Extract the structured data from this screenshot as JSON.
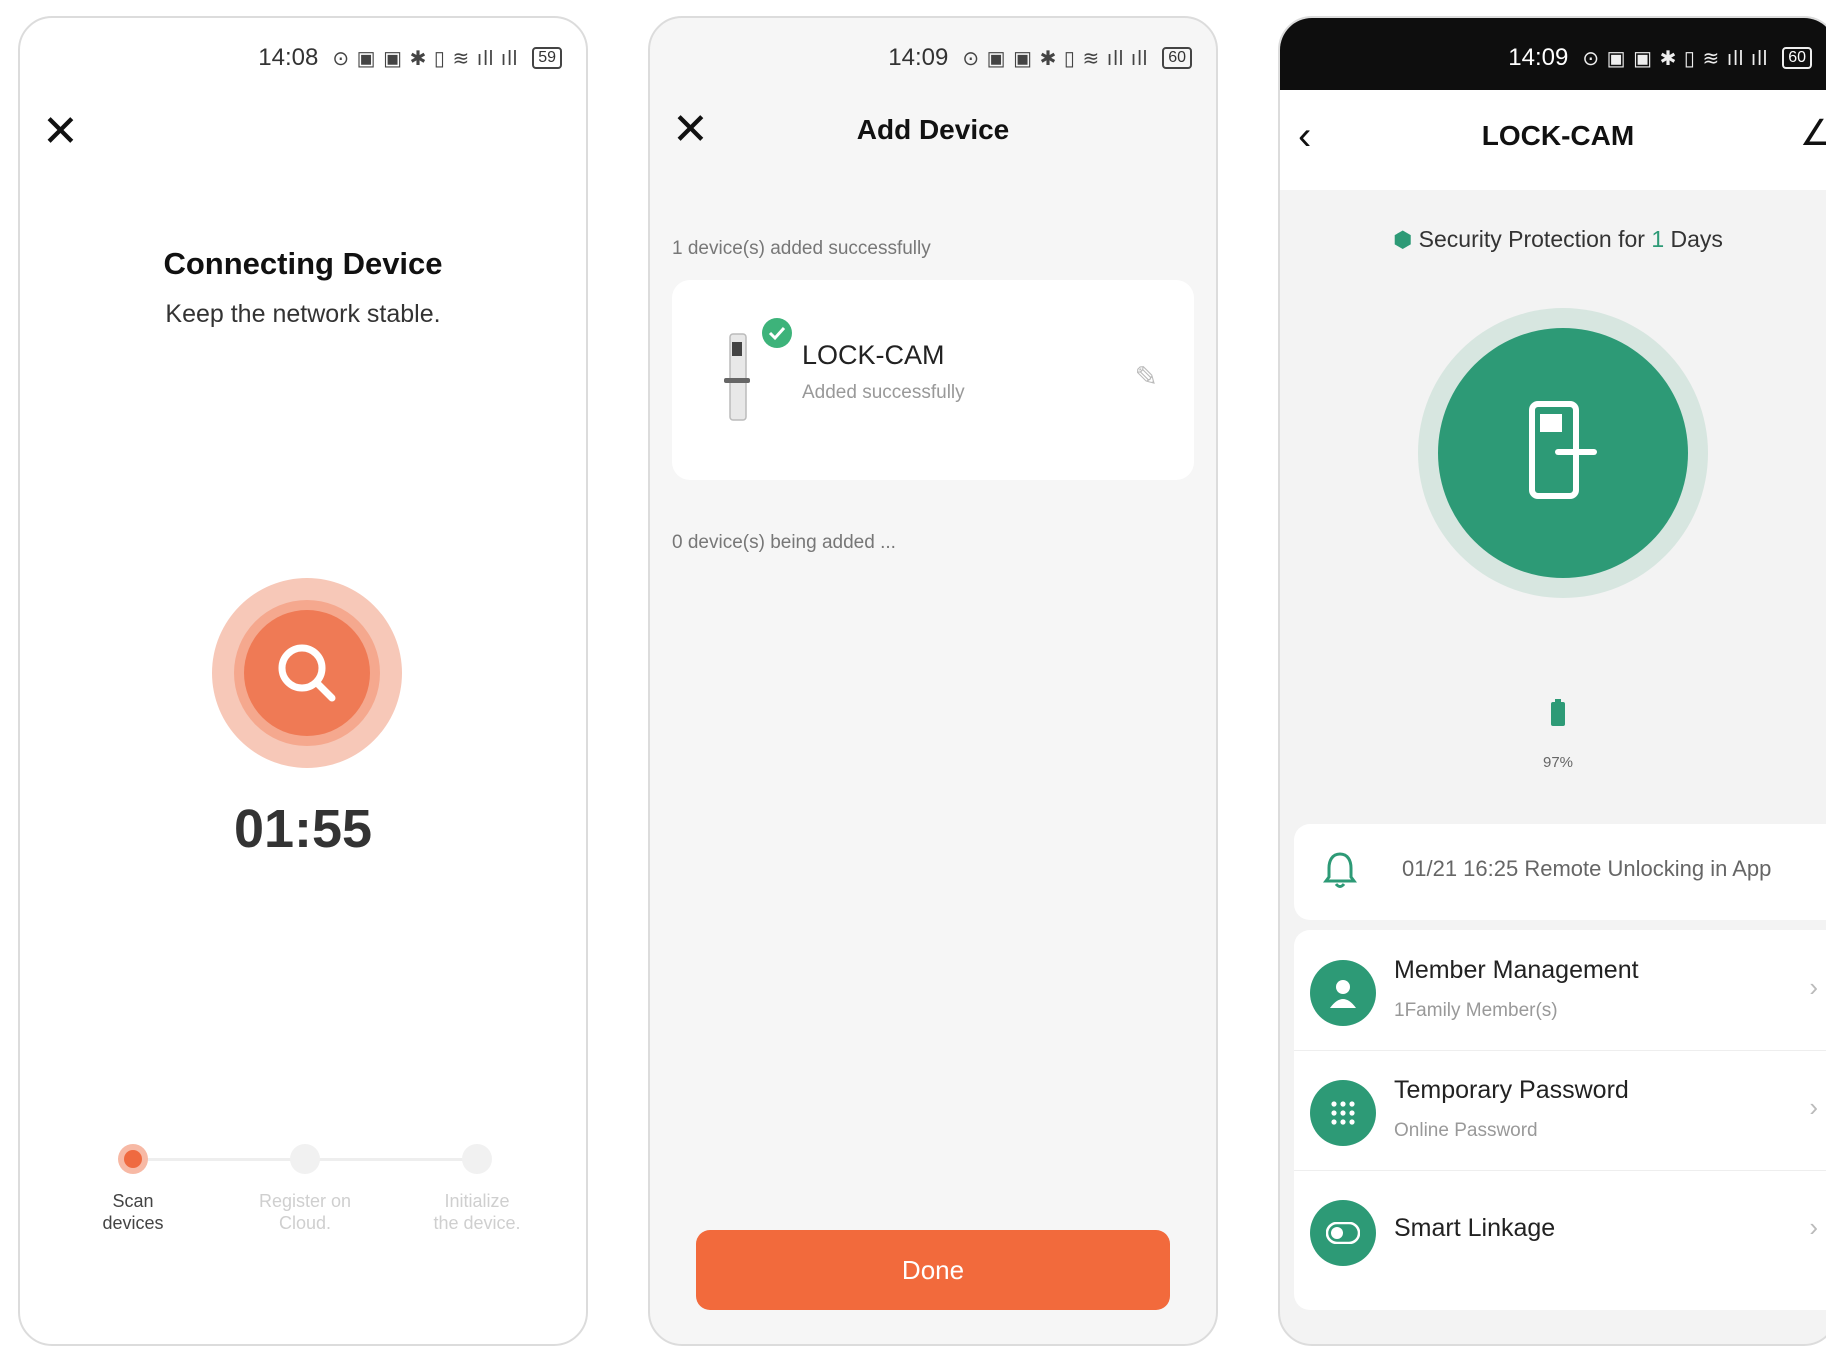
{
  "screen1": {
    "status_time": "14:08",
    "status_icons": "⊙ ▣ ▣ ✱ ▯ ≋ ıll ıll",
    "battery": "59",
    "title": "Connecting Device",
    "subtitle": "Keep the network stable.",
    "timer": "01:55",
    "steps": [
      {
        "label_line1": "Scan",
        "label_line2": "devices",
        "state": "active"
      },
      {
        "label_line1": "Register on",
        "label_line2": "Cloud.",
        "state": "pending"
      },
      {
        "label_line1": "Initialize",
        "label_line2": "the device.",
        "state": "pending"
      }
    ]
  },
  "screen2": {
    "status_time": "14:09",
    "status_icons": "⊙ ▣ ▣ ✱ ▯ ≋ ıll ıll",
    "battery": "60",
    "title": "Add Device",
    "added_note": "1 device(s) added successfully",
    "device": {
      "name": "LOCK-CAM",
      "status": "Added successfully"
    },
    "adding_note": "0 device(s) being added ...",
    "done_label": "Done"
  },
  "screen3": {
    "status_time": "14:09",
    "status_icons": "⊙ ▣ ▣ ✱ ▯ ≋ ıll ıll",
    "battery": "60",
    "title": "LOCK-CAM",
    "security_prefix": "Security Protection for",
    "security_days": "1",
    "security_suffix": "Days",
    "battery_level": "97%",
    "log": "01/21 16:25 Remote Unlocking in App",
    "menu": [
      {
        "title": "Member Management",
        "subtitle": "1Family Member(s)"
      },
      {
        "title": "Temporary Password",
        "subtitle": "Online Password"
      },
      {
        "title": "Smart Linkage",
        "subtitle": ""
      }
    ]
  },
  "colors": {
    "accent_orange": "#ef7a55",
    "button_orange": "#f26a3c",
    "lock_green": "#2d9a76",
    "check_green": "#3db37a"
  }
}
